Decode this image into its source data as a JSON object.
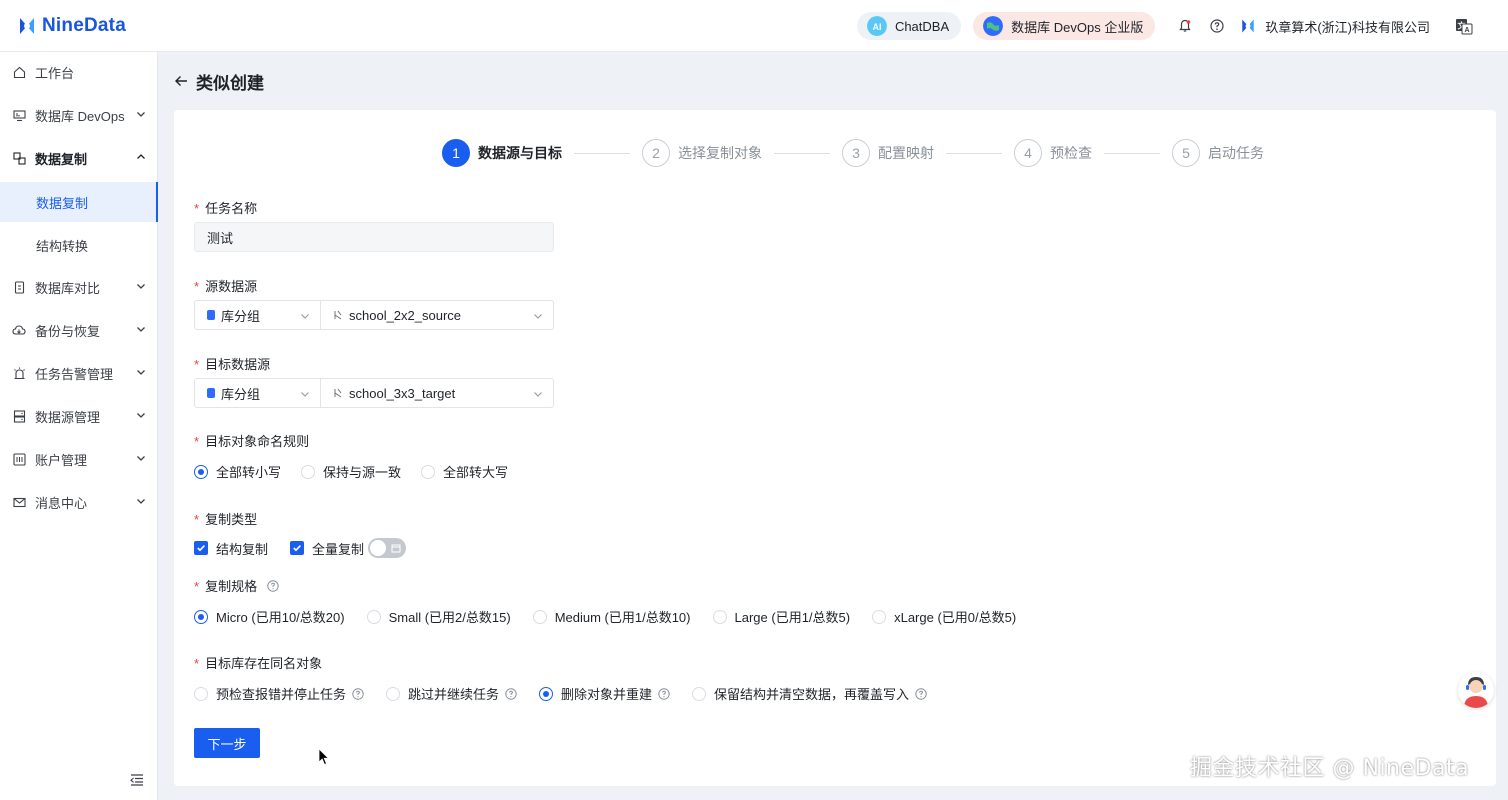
{
  "header": {
    "brand": "NineData",
    "chatdba": "ChatDBA",
    "edition": "数据库 DevOps 企业版",
    "org": "玖章算术(浙江)科技有限公司",
    "icons": [
      "bell-icon",
      "help-icon",
      "language-icon"
    ]
  },
  "sidebar": {
    "items": [
      {
        "label": "工作台",
        "icon": "home-icon"
      },
      {
        "label": "数据库 DevOps",
        "icon": "monitor-icon"
      },
      {
        "label": "数据复制",
        "icon": "replicate-icon"
      },
      {
        "label": "数据复制"
      },
      {
        "label": "结构转换"
      },
      {
        "label": "数据库对比",
        "icon": "compare-icon"
      },
      {
        "label": "备份与恢复",
        "icon": "cloud-icon"
      },
      {
        "label": "任务告警管理",
        "icon": "alarm-icon"
      },
      {
        "label": "数据源管理",
        "icon": "datasource-icon"
      },
      {
        "label": "账户管理",
        "icon": "account-icon"
      },
      {
        "label": "消息中心",
        "icon": "mail-icon"
      }
    ]
  },
  "page": {
    "title": "类似创建"
  },
  "steps": [
    {
      "num": "1",
      "label": "数据源与目标"
    },
    {
      "num": "2",
      "label": "选择复制对象"
    },
    {
      "num": "3",
      "label": "配置映射"
    },
    {
      "num": "4",
      "label": "预检查"
    },
    {
      "num": "5",
      "label": "启动任务"
    }
  ],
  "form": {
    "required_mark": "*",
    "task_name": {
      "label": "任务名称",
      "value": "测试"
    },
    "source": {
      "label": "源数据源",
      "group": "库分组",
      "instance": "school_2x2_source"
    },
    "target": {
      "label": "目标数据源",
      "group": "库分组",
      "instance": "school_3x3_target"
    },
    "naming": {
      "label": "目标对象命名规则",
      "options": [
        "全部转小写",
        "保持与源一致",
        "全部转大写"
      ],
      "selected": "全部转小写"
    },
    "copy_type": {
      "label": "复制类型",
      "options": [
        "结构复制",
        "全量复制"
      ]
    },
    "spec": {
      "label": "复制规格",
      "options": [
        "Micro (已用10/总数20)",
        "Small (已用2/总数15)",
        "Medium (已用1/总数10)",
        "Large (已用1/总数5)",
        "xLarge (已用0/总数5)"
      ],
      "selected": "Micro (已用10/总数20)"
    },
    "conflict": {
      "label": "目标库存在同名对象",
      "options": [
        "预检查报错并停止任务",
        "跳过并继续任务",
        "删除对象并重建",
        "保留结构并清空数据，再覆盖写入"
      ],
      "selected": "删除对象并重建"
    },
    "next_label": "下一步"
  },
  "watermark": "掘金技术社区 @ NineData",
  "colors": {
    "primary": "#1a5ef0",
    "required": "#f04134"
  }
}
